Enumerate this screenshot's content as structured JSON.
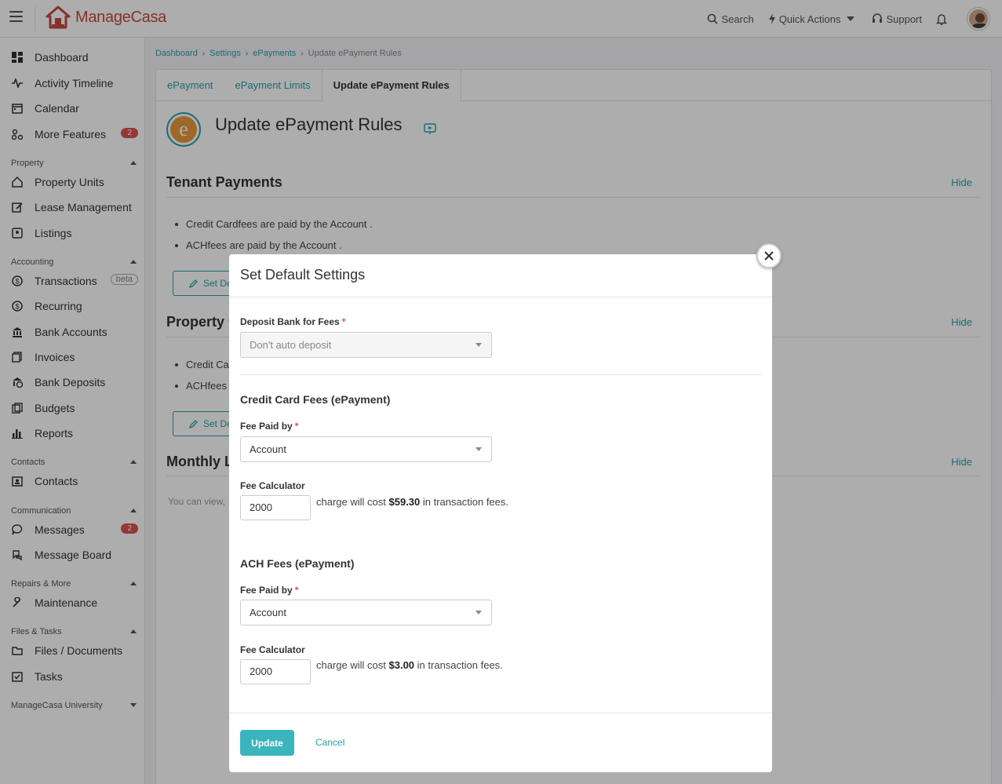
{
  "app": {
    "logo_text": "ManageCasa"
  },
  "topnav": {
    "search": "Search",
    "quick_actions": "Quick Actions",
    "support": "Support"
  },
  "sidebar": {
    "items": [
      {
        "label": "Dashboard",
        "icon": "dashboard-icon"
      },
      {
        "label": "Activity Timeline",
        "icon": "activity-icon"
      },
      {
        "label": "Calendar",
        "icon": "calendar-icon"
      },
      {
        "label": "More Features",
        "icon": "features-icon",
        "badge": "2"
      },
      {
        "label": "Property Units",
        "icon": "home-icon"
      },
      {
        "label": "Lease Management",
        "icon": "lease-icon"
      },
      {
        "label": "Listings",
        "icon": "listing-icon"
      },
      {
        "label": "Transactions",
        "icon": "dollar-icon",
        "tag": "beta"
      },
      {
        "label": "Recurring",
        "icon": "recurring-icon"
      },
      {
        "label": "Bank Accounts",
        "icon": "bank-icon"
      },
      {
        "label": "Invoices",
        "icon": "invoice-icon"
      },
      {
        "label": "Bank Deposits",
        "icon": "deposit-icon"
      },
      {
        "label": "Budgets",
        "icon": "budget-icon"
      },
      {
        "label": "Reports",
        "icon": "reports-icon"
      },
      {
        "label": "Contacts",
        "icon": "contacts-icon"
      },
      {
        "label": "Messages",
        "icon": "messages-icon",
        "badge": "2"
      },
      {
        "label": "Message Board",
        "icon": "message-board-icon"
      },
      {
        "label": "Maintenance",
        "icon": "maintenance-icon"
      },
      {
        "label": "Files / Documents",
        "icon": "folder-icon"
      },
      {
        "label": "Tasks",
        "icon": "tasks-icon"
      }
    ],
    "sections": [
      "Property",
      "Accounting",
      "Contacts",
      "Communication",
      "Repairs & More",
      "Files & Tasks",
      "ManageCasa University"
    ]
  },
  "breadcrumb": [
    "Dashboard",
    "Settings",
    "ePayments",
    "Update ePayment Rules"
  ],
  "tabs": [
    "ePayment",
    "ePayment Limits",
    "Update ePayment Rules"
  ],
  "page": {
    "title": "Update ePayment Rules",
    "hide": "Hide",
    "tenant": {
      "title": "Tenant Payments",
      "bullets": [
        "Credit Cardfees are paid by the Account .",
        "ACHfees are paid by the Account ."
      ],
      "button": "Set De"
    },
    "property": {
      "title": "Property C",
      "bullets": [
        "Credit Ca",
        "ACHfees a"
      ],
      "button": "Set De"
    },
    "monthly": {
      "title": "Monthly L",
      "text": "You can view,"
    }
  },
  "modal": {
    "title": "Set Default Settings",
    "deposit_label": "Deposit Bank for Fees",
    "req": "*",
    "deposit_value": "Don't auto deposit",
    "cc_title": "Credit Card Fees (ePayment)",
    "fee_paid_label": "Fee Paid by",
    "cc_fee_paid": "Account",
    "calc_label": "Fee Calculator",
    "cc_amount": "2000",
    "calc_prefix": "charge will cost",
    "cc_cost": "$59.30",
    "calc_suffix": "in transaction fees.",
    "ach_title": "ACH Fees (ePayment)",
    "ach_fee_paid": "Account",
    "ach_amount": "2000",
    "ach_cost": "$3.00",
    "update": "Update",
    "cancel": "Cancel"
  }
}
